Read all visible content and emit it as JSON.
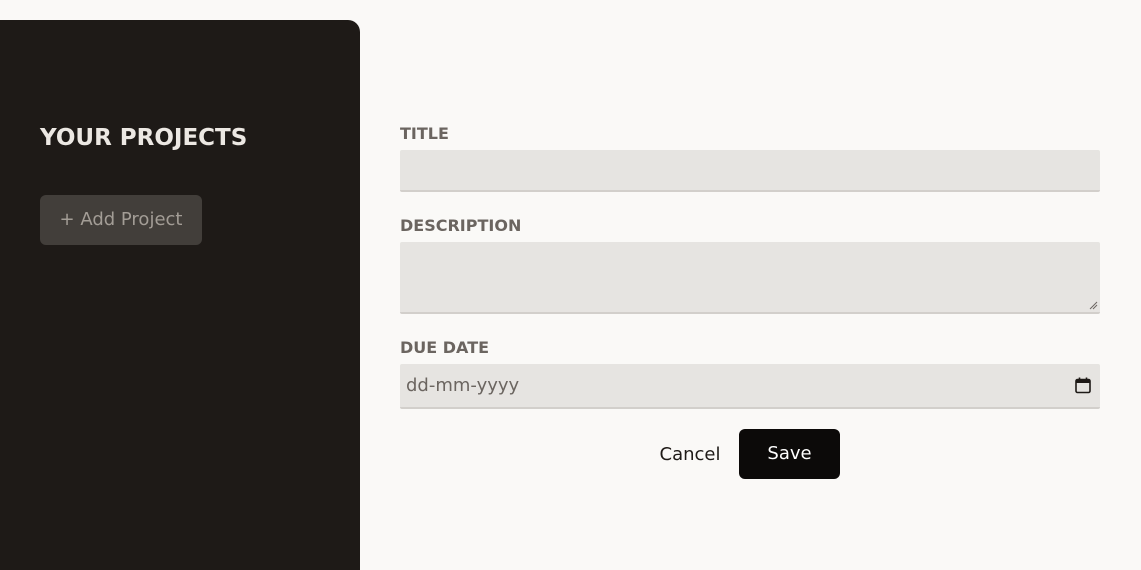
{
  "sidebar": {
    "title": "YOUR PROJECTS",
    "add_project_label": "+ Add Project"
  },
  "form": {
    "title_label": "TITLE",
    "title_value": "",
    "description_label": "DESCRIPTION",
    "description_value": "",
    "due_date_label": "DUE DATE",
    "due_date_placeholder": "dd-mm-yyyy",
    "due_date_icon": "calendar-icon",
    "cancel_label": "Cancel",
    "save_label": "Save"
  },
  "colors": {
    "sidebar_bg": "#1e1a17",
    "page_bg": "#faf9f7",
    "input_bg": "#e6e4e1",
    "save_button_bg": "#0c0a09",
    "add_button_bg": "#423e3a"
  }
}
